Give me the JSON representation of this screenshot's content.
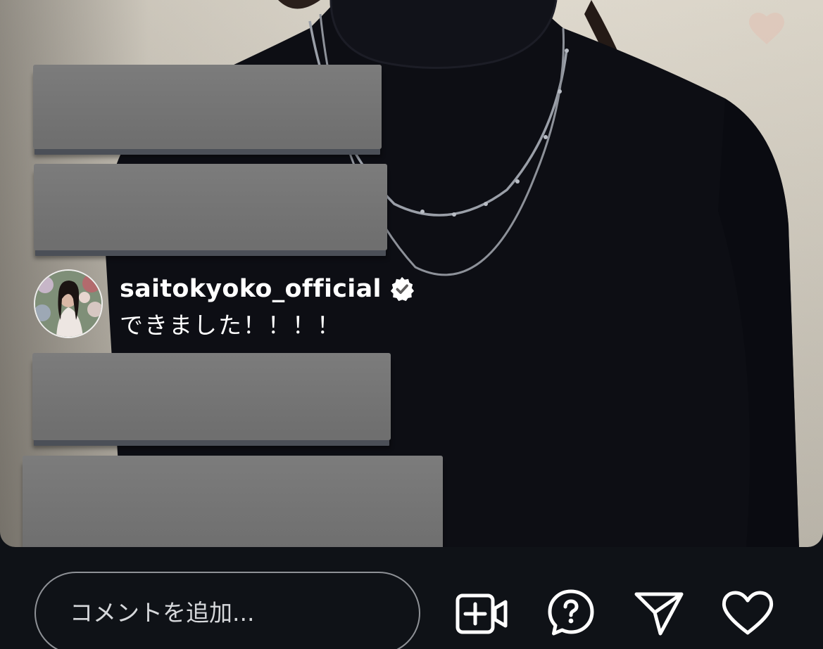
{
  "comments": [
    {
      "username": "saitokyoko_official",
      "verified": true,
      "text": "できました！！！！"
    }
  ],
  "input": {
    "placeholder": "コメントを追加..."
  },
  "actions": [
    {
      "name": "add-video-icon"
    },
    {
      "name": "question-icon"
    },
    {
      "name": "send-icon"
    },
    {
      "name": "heart-icon"
    }
  ],
  "colors": {
    "bar_background": "#0f1217",
    "overlay_gray": "#767676",
    "verified_badge": "#ffffff"
  }
}
